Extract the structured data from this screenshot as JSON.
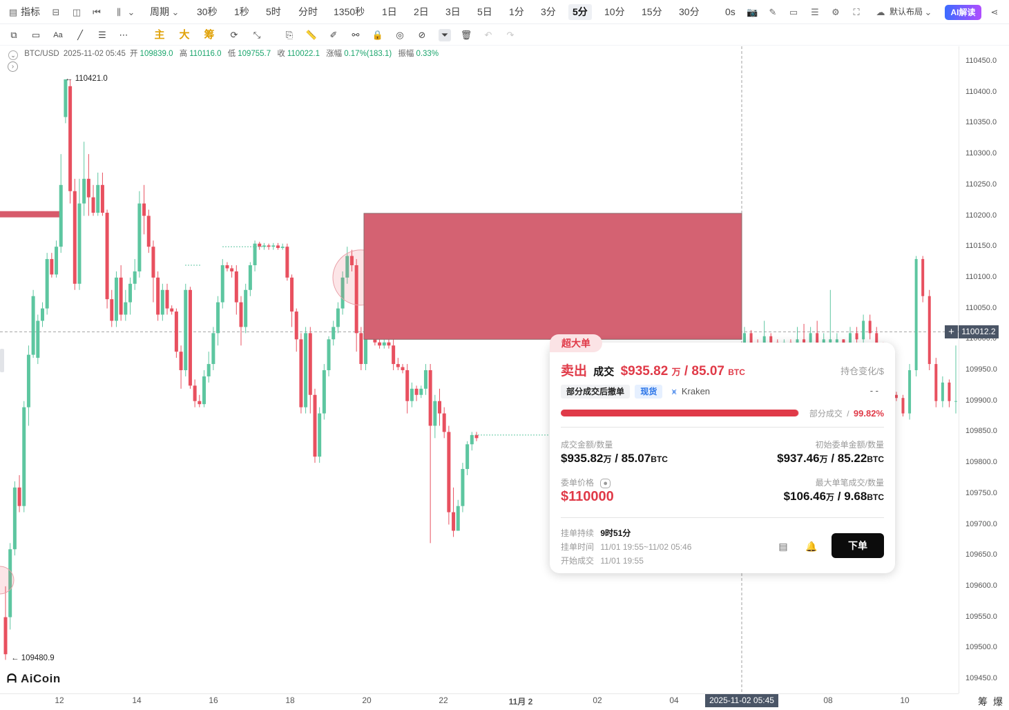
{
  "topbar": {
    "indicator_label": "指标",
    "period_label": "周期",
    "intervals": [
      "30秒",
      "1秒",
      "5时",
      "分时",
      "1350秒",
      "1日",
      "2日",
      "3日",
      "5日",
      "1分",
      "3分",
      "5分",
      "10分",
      "15分",
      "30分"
    ],
    "active_interval": "5分",
    "countdown": "0s",
    "layout_label": "默认布局",
    "ai_label": "AI解读"
  },
  "drawing_toolbar": {
    "quick_labels": [
      "主",
      "大",
      "筹"
    ]
  },
  "ohlc": {
    "symbol": "BTC/USD",
    "datetime": "2025-11-02 05:45",
    "open_label": "开",
    "open": "109839.0",
    "high_label": "高",
    "high": "110116.0",
    "low_label": "低",
    "low": "109755.7",
    "close_label": "收",
    "close": "110022.1",
    "change_label": "涨幅",
    "change": "0.17%(183.1)",
    "amplitude_label": "振幅",
    "amplitude": "0.33%"
  },
  "chart_data": {
    "type": "candlestick",
    "y_range": [
      109425,
      110475
    ],
    "y_ticks": [
      "110450.0",
      "110400.0",
      "110350.0",
      "110300.0",
      "110250.0",
      "110200.0",
      "110150.0",
      "110100.0",
      "110050.0",
      "110000.0",
      "109950.0",
      "109900.0",
      "109850.0",
      "109800.0",
      "109750.0",
      "109700.0",
      "109650.0",
      "109600.0",
      "109550.0",
      "109500.0",
      "109450.0"
    ],
    "x_ticks": [
      "12",
      "14",
      "16",
      "18",
      "20",
      "22",
      "11月 2",
      "02",
      "04",
      "2025-11-02 05:45",
      "08",
      "10"
    ],
    "current_price": "110012.2",
    "high_marker": "110421.0",
    "low_marker": "109480.9",
    "large_order_zone": {
      "price_low": 110000,
      "price_high": 110204,
      "color": "#d46272"
    },
    "orderbook_line": {
      "price": 110202,
      "color": "#d75b6b"
    },
    "candles": [
      [
        109490,
        109550,
        109480.9,
        109600,
        0
      ],
      [
        109550,
        109660,
        109530,
        109670,
        1
      ],
      [
        109660,
        109760,
        109650,
        109770,
        1
      ],
      [
        109760,
        109730,
        109720,
        109780,
        0
      ],
      [
        109730,
        109890,
        109720,
        109900,
        1
      ],
      [
        109890,
        109975,
        109860,
        109990,
        1
      ],
      [
        109975,
        110070,
        109970,
        110080,
        1
      ],
      [
        109970,
        110030,
        109960,
        110040,
        1
      ],
      [
        110030,
        110050,
        110020,
        110060,
        1
      ],
      [
        110050,
        110130,
        110040,
        110140,
        1
      ],
      [
        110130,
        110105,
        110100,
        110140,
        0
      ],
      [
        110105,
        110150,
        110100,
        110160,
        1
      ],
      [
        110150,
        110250,
        110140,
        110300,
        1
      ],
      [
        110360,
        110421,
        110350,
        110421,
        1
      ],
      [
        110410,
        110240,
        110220,
        110421,
        0
      ],
      [
        110240,
        110090,
        110080,
        110260,
        0
      ],
      [
        110090,
        110220,
        110080,
        110260,
        1
      ],
      [
        110220,
        110260,
        110200,
        110320,
        1
      ],
      [
        110260,
        110230,
        110200,
        110300,
        0
      ],
      [
        110230,
        110205,
        110200,
        110250,
        0
      ],
      [
        110205,
        110250,
        110200,
        110270,
        1
      ],
      [
        110250,
        110205,
        110200,
        110270,
        0
      ],
      [
        110205,
        110065,
        110050,
        110210,
        0
      ],
      [
        110065,
        110030,
        110020,
        110080,
        0
      ],
      [
        110030,
        110100,
        110020,
        110110,
        1
      ],
      [
        110100,
        110040,
        110030,
        110120,
        0
      ],
      [
        110040,
        110060,
        110030,
        110080,
        1
      ],
      [
        110060,
        110090,
        110040,
        110100,
        1
      ],
      [
        110090,
        110110,
        110080,
        110130,
        1
      ],
      [
        110110,
        110220,
        110100,
        110240,
        1
      ],
      [
        110220,
        110200,
        110170,
        110250,
        0
      ],
      [
        110200,
        110150,
        110140,
        110210,
        0
      ],
      [
        110150,
        110100,
        110060,
        110160,
        0
      ],
      [
        110100,
        110040,
        110030,
        110110,
        0
      ],
      [
        110040,
        110080,
        110030,
        110090,
        1
      ],
      [
        110080,
        110050,
        110040,
        110090,
        0
      ],
      [
        110050,
        110045,
        110040,
        110055,
        0
      ],
      [
        110045,
        109980,
        109970,
        110050,
        0
      ],
      [
        109980,
        109950,
        109920,
        109990,
        0
      ],
      [
        109950,
        110080,
        109940,
        110090,
        1
      ],
      [
        110080,
        109925,
        109920,
        110085,
        0
      ],
      [
        109925,
        109900,
        109890,
        109935,
        0
      ],
      [
        109900,
        109895,
        109890,
        109910,
        0
      ],
      [
        109895,
        109940,
        109890,
        109950,
        1
      ],
      [
        109940,
        109960,
        109930,
        109980,
        1
      ],
      [
        109960,
        110010,
        109950,
        110020,
        1
      ],
      [
        110010,
        110060,
        109990,
        110070,
        1
      ],
      [
        110060,
        110120,
        110050,
        110130,
        1
      ],
      [
        110120,
        110115,
        110110,
        110125,
        0
      ],
      [
        110115,
        110110,
        110100,
        110120,
        0
      ],
      [
        110110,
        110060,
        110040,
        110120,
        0
      ],
      [
        110060,
        110020,
        109990,
        110070,
        0
      ],
      [
        110020,
        110080,
        110010,
        110090,
        1
      ],
      [
        110080,
        110120,
        110070,
        110125,
        1
      ],
      [
        110120,
        110155,
        110110,
        110160,
        1
      ],
      [
        110155,
        110150,
        110145,
        110158,
        0
      ],
      [
        110150,
        110152,
        110145,
        110156,
        1
      ],
      [
        110152,
        110150,
        110145,
        110155,
        0
      ],
      [
        110150,
        110152,
        110145,
        110156,
        1
      ],
      [
        110152,
        110148,
        110145,
        110156,
        0
      ],
      [
        110148,
        110150,
        110145,
        110155,
        1
      ],
      [
        110150,
        110100,
        110095,
        110155,
        0
      ],
      [
        110100,
        110045,
        110020,
        110105,
        0
      ],
      [
        110045,
        110000,
        109980,
        110050,
        0
      ],
      [
        110000,
        109890,
        109880,
        110010,
        0
      ],
      [
        109890,
        110010,
        109880,
        110020,
        1
      ],
      [
        110010,
        109910,
        109880,
        110020,
        0
      ],
      [
        109910,
        109810,
        109800,
        109920,
        0
      ],
      [
        109810,
        109880,
        109800,
        109890,
        1
      ],
      [
        109880,
        109950,
        109870,
        109960,
        1
      ],
      [
        109950,
        110000,
        109940,
        110005,
        1
      ],
      [
        110000,
        110020,
        109990,
        110030,
        1
      ],
      [
        110020,
        110050,
        110010,
        110060,
        1
      ],
      [
        110050,
        110100,
        110040,
        110110,
        1
      ],
      [
        110100,
        110135,
        110090,
        110150,
        1
      ],
      [
        110135,
        110120,
        110110,
        110145,
        0
      ],
      [
        110120,
        110010,
        109980,
        110130,
        0
      ],
      [
        110010,
        109960,
        109950,
        110020,
        0
      ],
      [
        109960,
        110050,
        109950,
        110060,
        1
      ],
      [
        110050,
        110060,
        110040,
        110070,
        1
      ],
      [
        110060,
        109995,
        109990,
        110070,
        0
      ],
      [
        109995,
        109990,
        109985,
        110000,
        0
      ],
      [
        109990,
        109995,
        109985,
        110000,
        1
      ],
      [
        109995,
        109990,
        109985,
        110000,
        0
      ],
      [
        109990,
        109960,
        109950,
        110000,
        0
      ],
      [
        109960,
        109955,
        109950,
        109970,
        0
      ],
      [
        109955,
        109950,
        109945,
        109960,
        0
      ],
      [
        109950,
        109900,
        109880,
        109960,
        0
      ],
      [
        109900,
        109920,
        109890,
        109930,
        1
      ],
      [
        109920,
        109910,
        109900,
        109925,
        0
      ],
      [
        109910,
        109920,
        109905,
        109925,
        1
      ],
      [
        109920,
        109950,
        109910,
        109960,
        1
      ],
      [
        109950,
        109860,
        109670,
        109960,
        0
      ],
      [
        109860,
        109900,
        109840,
        109910,
        1
      ],
      [
        109900,
        109880,
        109860,
        109920,
        0
      ],
      [
        109880,
        109850,
        109840,
        109890,
        0
      ],
      [
        109850,
        109720,
        109700,
        109860,
        0
      ],
      [
        109720,
        109690,
        109680,
        109760,
        0
      ],
      [
        109690,
        109730,
        109690,
        109740,
        1
      ],
      [
        109730,
        109790,
        109720,
        109800,
        1
      ],
      [
        109790,
        109830,
        109780,
        109835,
        1
      ],
      [
        109830,
        109845,
        109820,
        109850,
        1
      ],
      [
        109845,
        109840,
        109835,
        109850,
        0
      ]
    ],
    "right_candles": [
      [
        109980,
        110010,
        109970,
        110020,
        1
      ],
      [
        110010,
        109990,
        109980,
        110015,
        0
      ],
      [
        109990,
        109985,
        109980,
        110000,
        0
      ],
      [
        109985,
        110005,
        109980,
        110030,
        1
      ],
      [
        110005,
        109995,
        109985,
        110010,
        0
      ],
      [
        109995,
        109990,
        109985,
        110000,
        0
      ],
      [
        109990,
        109995,
        109985,
        110000,
        1
      ],
      [
        109995,
        109990,
        109980,
        110000,
        0
      ],
      [
        109990,
        110000,
        109980,
        110020,
        1
      ],
      [
        110000,
        109995,
        109990,
        110025,
        0
      ],
      [
        109995,
        110010,
        109990,
        110020,
        1
      ],
      [
        110010,
        109990,
        109985,
        110030,
        0
      ],
      [
        109990,
        110000,
        109985,
        110010,
        1
      ],
      [
        110000,
        109995,
        109990,
        110080,
        1
      ],
      [
        109995,
        110000,
        109990,
        110010,
        1
      ],
      [
        110000,
        109990,
        109985,
        110000,
        0
      ],
      [
        109990,
        110010,
        109985,
        110020,
        1
      ],
      [
        110010,
        110000,
        109990,
        110020,
        0
      ],
      [
        110000,
        110030,
        109990,
        110040,
        1
      ],
      [
        110030,
        110010,
        110000,
        110040,
        0
      ],
      [
        110010,
        109990,
        109970,
        110020,
        0
      ],
      [
        109990,
        109960,
        109950,
        109995,
        0
      ],
      [
        109960,
        109910,
        109900,
        109970,
        0
      ],
      [
        109910,
        109905,
        109900,
        109915,
        0
      ],
      [
        109905,
        109880,
        109875,
        109910,
        0
      ],
      [
        109880,
        109950,
        109870,
        109960,
        1
      ],
      [
        109950,
        110130,
        109940,
        110135,
        1
      ],
      [
        110130,
        110070,
        110060,
        110135,
        0
      ],
      [
        110070,
        109960,
        109950,
        110080,
        0
      ],
      [
        109960,
        109900,
        109890,
        109970,
        0
      ],
      [
        109900,
        109930,
        109890,
        109940,
        1
      ],
      [
        109930,
        109900,
        109890,
        109935,
        0
      ],
      [
        109900,
        109900,
        109880,
        109990,
        1
      ]
    ]
  },
  "popup": {
    "tag": "超大单",
    "side": "卖出",
    "deal_label": "成交",
    "amount": "$935.82",
    "amount_unit": "万",
    "qty": "/ 85.07",
    "qty_unit": "BTC",
    "position_change_label": "持仓变化/$",
    "chip_status": "部分成交后撤单",
    "chip_market": "现货",
    "exchange": "Kraken",
    "position_change_value": "- -",
    "fill_label": "部分成交",
    "fill_sep": "/",
    "fill_percent": "99.82%",
    "fill_fraction": 0.9982,
    "deal_amount_label": "成交金额/数量",
    "deal_amount_value": "$935.82",
    "deal_amount_unit": "万",
    "deal_qty_value": "/ 85.07",
    "deal_qty_unit": "BTC",
    "initial_label": "初始委单金额/数量",
    "initial_amount": "$937.46",
    "initial_unit": "万",
    "initial_qty": "/ 85.22",
    "initial_qty_unit": "BTC",
    "order_price_label": "委单价格",
    "order_price": "$110000",
    "max_fill_label": "最大单笔成交/数量",
    "max_fill_amount": "$106.46",
    "max_fill_unit": "万",
    "max_fill_qty": "/ 9.68",
    "max_fill_qty_unit": "BTC",
    "duration_label": "挂单持续",
    "duration_value": "9时51分",
    "time_label": "挂单时间",
    "time_value": "11/01 19:55~11/02 05:46",
    "start_label": "开始成交",
    "start_value": "11/01 19:55",
    "order_button": "下单"
  },
  "bottom": {
    "corner_left": "筹",
    "corner_right": "爆",
    "logo": "AiCoin"
  },
  "colors": {
    "up": "#5dc6a0",
    "down": "#e8505f",
    "accent_red": "#e03a48"
  }
}
